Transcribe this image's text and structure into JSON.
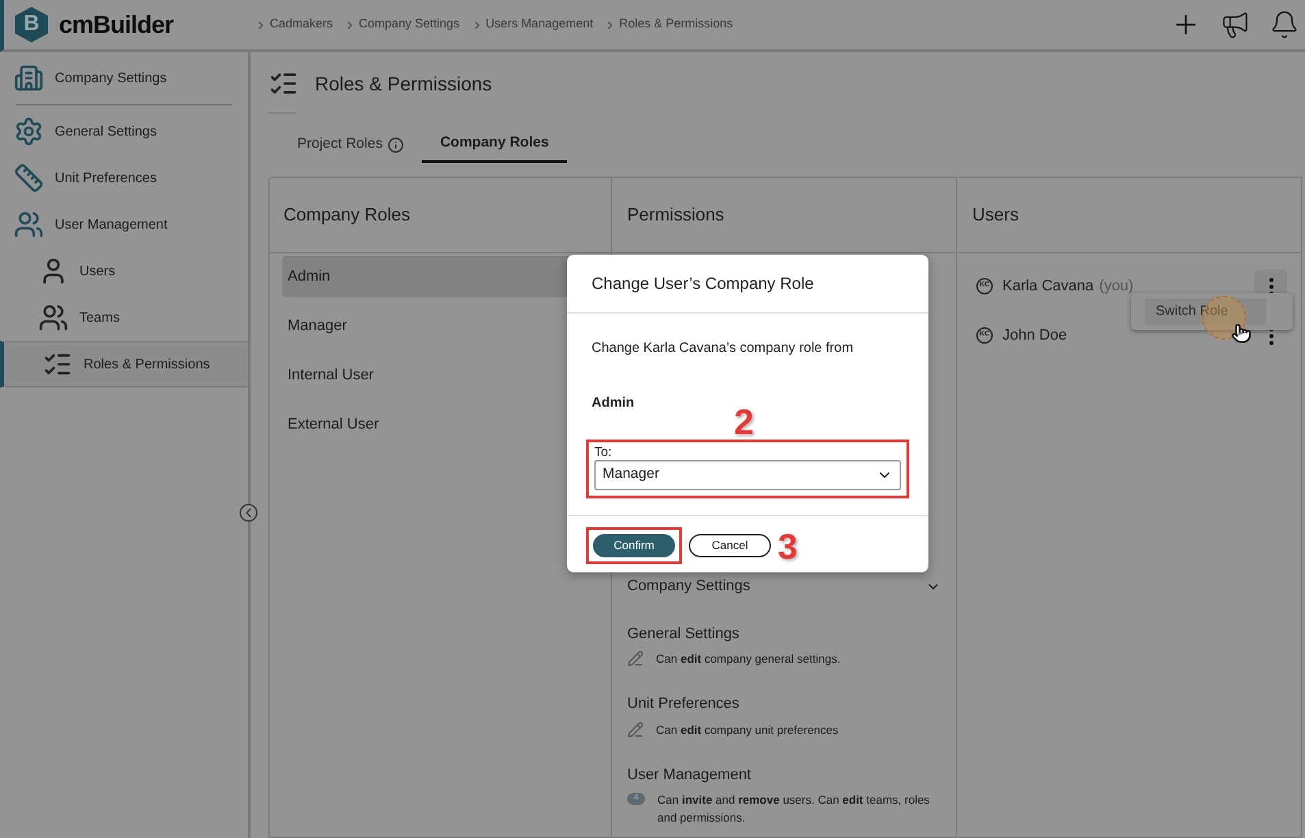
{
  "header": {
    "logo_letter": "B",
    "logo_text": "cmBuilder",
    "breadcrumbs": [
      "Cadmakers",
      "Company Settings",
      "Users Management",
      "Roles & Permissions"
    ]
  },
  "sidebar": {
    "items": [
      {
        "label": "Company Settings",
        "kind": "building",
        "selected": false
      },
      {
        "label": "General Settings",
        "kind": "gear",
        "selected": false
      },
      {
        "label": "Unit Preferences",
        "kind": "ruler",
        "selected": false
      },
      {
        "label": "User Management",
        "kind": "people",
        "selected": false,
        "children": [
          {
            "label": "Users",
            "kind": "person",
            "selected": false
          },
          {
            "label": "Teams",
            "kind": "team",
            "selected": false
          },
          {
            "label": "Roles & Permissions",
            "kind": "roles",
            "selected": true
          }
        ]
      }
    ]
  },
  "page": {
    "title": "Roles & Permissions",
    "tabs": [
      {
        "label": "Project Roles",
        "info": true,
        "selected": false
      },
      {
        "label": "Company Roles",
        "info": false,
        "selected": true
      }
    ]
  },
  "roles_panel": {
    "title": "Company Roles",
    "roles": [
      {
        "label": "Admin",
        "selected": true
      },
      {
        "label": "Manager",
        "selected": false
      },
      {
        "label": "Internal User",
        "selected": false
      },
      {
        "label": "External User",
        "selected": false
      }
    ]
  },
  "permissions_panel": {
    "title": "Permissions",
    "section": "Company Settings",
    "groups": [
      {
        "title": "General Settings",
        "kind": "edit",
        "text": "Can **edit** company general settings."
      },
      {
        "title": "Unit Preferences",
        "kind": "edit",
        "text": "Can **edit** company unit preferences"
      },
      {
        "title": "User Management",
        "kind": "count",
        "badge": "4",
        "text": "Can **invite** and **remove** users. Can **edit** teams, roles and permissions."
      }
    ]
  },
  "users_panel": {
    "title": "Users",
    "users": [
      {
        "initials": "KC",
        "name": "Karla Cavana",
        "note": "(you)"
      },
      {
        "initials": "KC",
        "name": "John Doe"
      }
    ],
    "menu": {
      "item": "Switch Role"
    }
  },
  "dialog": {
    "title": "Change User’s Company Role",
    "message": "Change Karla Cavana’s company role from",
    "from": "Admin",
    "to_label": "To:",
    "to_value": "Manager",
    "confirm": "Confirm",
    "cancel": "Cancel"
  },
  "annotations": [
    {
      "label": "2"
    },
    {
      "label": "3"
    }
  ]
}
